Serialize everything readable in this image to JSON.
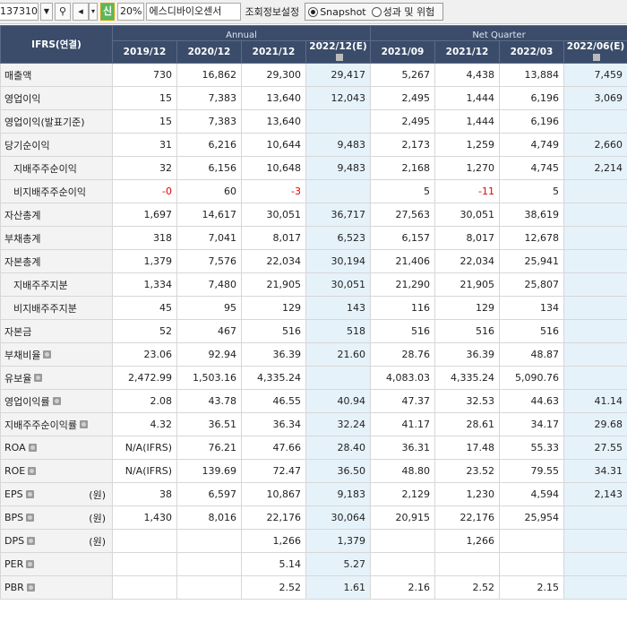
{
  "toolbar": {
    "code_value": "137310",
    "zoom": "20%",
    "company": "에스디바이오센서",
    "config_label": "조회정보설정",
    "sin_label": "신",
    "radio_options": [
      {
        "label": "Snapshot",
        "selected": true
      },
      {
        "label": "성과 및 위험",
        "selected": false
      }
    ]
  },
  "table": {
    "corner_label": "IFRS(연결)",
    "group_labels": [
      "Annual",
      "Net Quarter"
    ],
    "periods": [
      "2019/12",
      "2020/12",
      "2021/12",
      "2022/12(E)",
      "2021/09",
      "2021/12",
      "2022/03",
      "2022/06(E)"
    ],
    "rows": [
      {
        "label": "매출액",
        "indent": false,
        "icon": false,
        "unit": "",
        "values": [
          "730",
          "16,862",
          "29,300",
          "29,417",
          "5,267",
          "4,438",
          "13,884",
          "7,459"
        ]
      },
      {
        "label": "영업이익",
        "indent": false,
        "icon": false,
        "unit": "",
        "values": [
          "15",
          "7,383",
          "13,640",
          "12,043",
          "2,495",
          "1,444",
          "6,196",
          "3,069"
        ]
      },
      {
        "label": "영업이익(발표기준)",
        "indent": false,
        "icon": false,
        "unit": "",
        "values": [
          "15",
          "7,383",
          "13,640",
          "",
          "2,495",
          "1,444",
          "6,196",
          ""
        ]
      },
      {
        "label": "당기순이익",
        "indent": false,
        "icon": false,
        "unit": "",
        "values": [
          "31",
          "6,216",
          "10,644",
          "9,483",
          "2,173",
          "1,259",
          "4,749",
          "2,660"
        ]
      },
      {
        "label": "지배주주순이익",
        "indent": true,
        "icon": false,
        "unit": "",
        "values": [
          "32",
          "6,156",
          "10,648",
          "9,483",
          "2,168",
          "1,270",
          "4,745",
          "2,214"
        ]
      },
      {
        "label": "비지배주주순이익",
        "indent": true,
        "icon": false,
        "unit": "",
        "values": [
          "-0",
          "60",
          "-3",
          "",
          "5",
          "-11",
          "5",
          ""
        ]
      },
      {
        "label": "자산총계",
        "indent": false,
        "icon": false,
        "unit": "",
        "values": [
          "1,697",
          "14,617",
          "30,051",
          "36,717",
          "27,563",
          "30,051",
          "38,619",
          ""
        ]
      },
      {
        "label": "부채총계",
        "indent": false,
        "icon": false,
        "unit": "",
        "values": [
          "318",
          "7,041",
          "8,017",
          "6,523",
          "6,157",
          "8,017",
          "12,678",
          ""
        ]
      },
      {
        "label": "자본총계",
        "indent": false,
        "icon": false,
        "unit": "",
        "values": [
          "1,379",
          "7,576",
          "22,034",
          "30,194",
          "21,406",
          "22,034",
          "25,941",
          ""
        ]
      },
      {
        "label": "지배주주지분",
        "indent": true,
        "icon": false,
        "unit": "",
        "values": [
          "1,334",
          "7,480",
          "21,905",
          "30,051",
          "21,290",
          "21,905",
          "25,807",
          ""
        ]
      },
      {
        "label": "비지배주주지분",
        "indent": true,
        "icon": false,
        "unit": "",
        "values": [
          "45",
          "95",
          "129",
          "143",
          "116",
          "129",
          "134",
          ""
        ]
      },
      {
        "label": "자본금",
        "indent": false,
        "icon": false,
        "unit": "",
        "values": [
          "52",
          "467",
          "516",
          "518",
          "516",
          "516",
          "516",
          ""
        ]
      },
      {
        "label": "부채비율",
        "indent": false,
        "icon": true,
        "unit": "",
        "values": [
          "23.06",
          "92.94",
          "36.39",
          "21.60",
          "28.76",
          "36.39",
          "48.87",
          ""
        ]
      },
      {
        "label": "유보율",
        "indent": false,
        "icon": true,
        "unit": "",
        "values": [
          "2,472.99",
          "1,503.16",
          "4,335.24",
          "",
          "4,083.03",
          "4,335.24",
          "5,090.76",
          ""
        ]
      },
      {
        "label": "영업이익률",
        "indent": false,
        "icon": true,
        "unit": "",
        "values": [
          "2.08",
          "43.78",
          "46.55",
          "40.94",
          "47.37",
          "32.53",
          "44.63",
          "41.14"
        ]
      },
      {
        "label": "지배주주순이익률",
        "indent": false,
        "icon": true,
        "unit": "",
        "values": [
          "4.32",
          "36.51",
          "36.34",
          "32.24",
          "41.17",
          "28.61",
          "34.17",
          "29.68"
        ]
      },
      {
        "label": "ROA",
        "indent": false,
        "icon": true,
        "unit": "",
        "values": [
          "N/A(IFRS)",
          "76.21",
          "47.66",
          "28.40",
          "36.31",
          "17.48",
          "55.33",
          "27.55"
        ]
      },
      {
        "label": "ROE",
        "indent": false,
        "icon": true,
        "unit": "",
        "values": [
          "N/A(IFRS)",
          "139.69",
          "72.47",
          "36.50",
          "48.80",
          "23.52",
          "79.55",
          "34.31"
        ]
      },
      {
        "label": "EPS",
        "indent": false,
        "icon": true,
        "unit": "(원)",
        "values": [
          "38",
          "6,597",
          "10,867",
          "9,183",
          "2,129",
          "1,230",
          "4,594",
          "2,143"
        ]
      },
      {
        "label": "BPS",
        "indent": false,
        "icon": true,
        "unit": "(원)",
        "values": [
          "1,430",
          "8,016",
          "22,176",
          "30,064",
          "20,915",
          "22,176",
          "25,954",
          ""
        ]
      },
      {
        "label": "DPS",
        "indent": false,
        "icon": true,
        "unit": "(원)",
        "values": [
          "",
          "",
          "1,266",
          "1,379",
          "",
          "1,266",
          "",
          ""
        ]
      },
      {
        "label": "PER",
        "indent": false,
        "icon": true,
        "unit": "",
        "values": [
          "",
          "",
          "5.14",
          "5.27",
          "",
          "",
          "",
          ""
        ]
      },
      {
        "label": "PBR",
        "indent": false,
        "icon": true,
        "unit": "",
        "values": [
          "",
          "",
          "2.52",
          "1.61",
          "2.16",
          "2.52",
          "2.15",
          ""
        ]
      }
    ]
  }
}
